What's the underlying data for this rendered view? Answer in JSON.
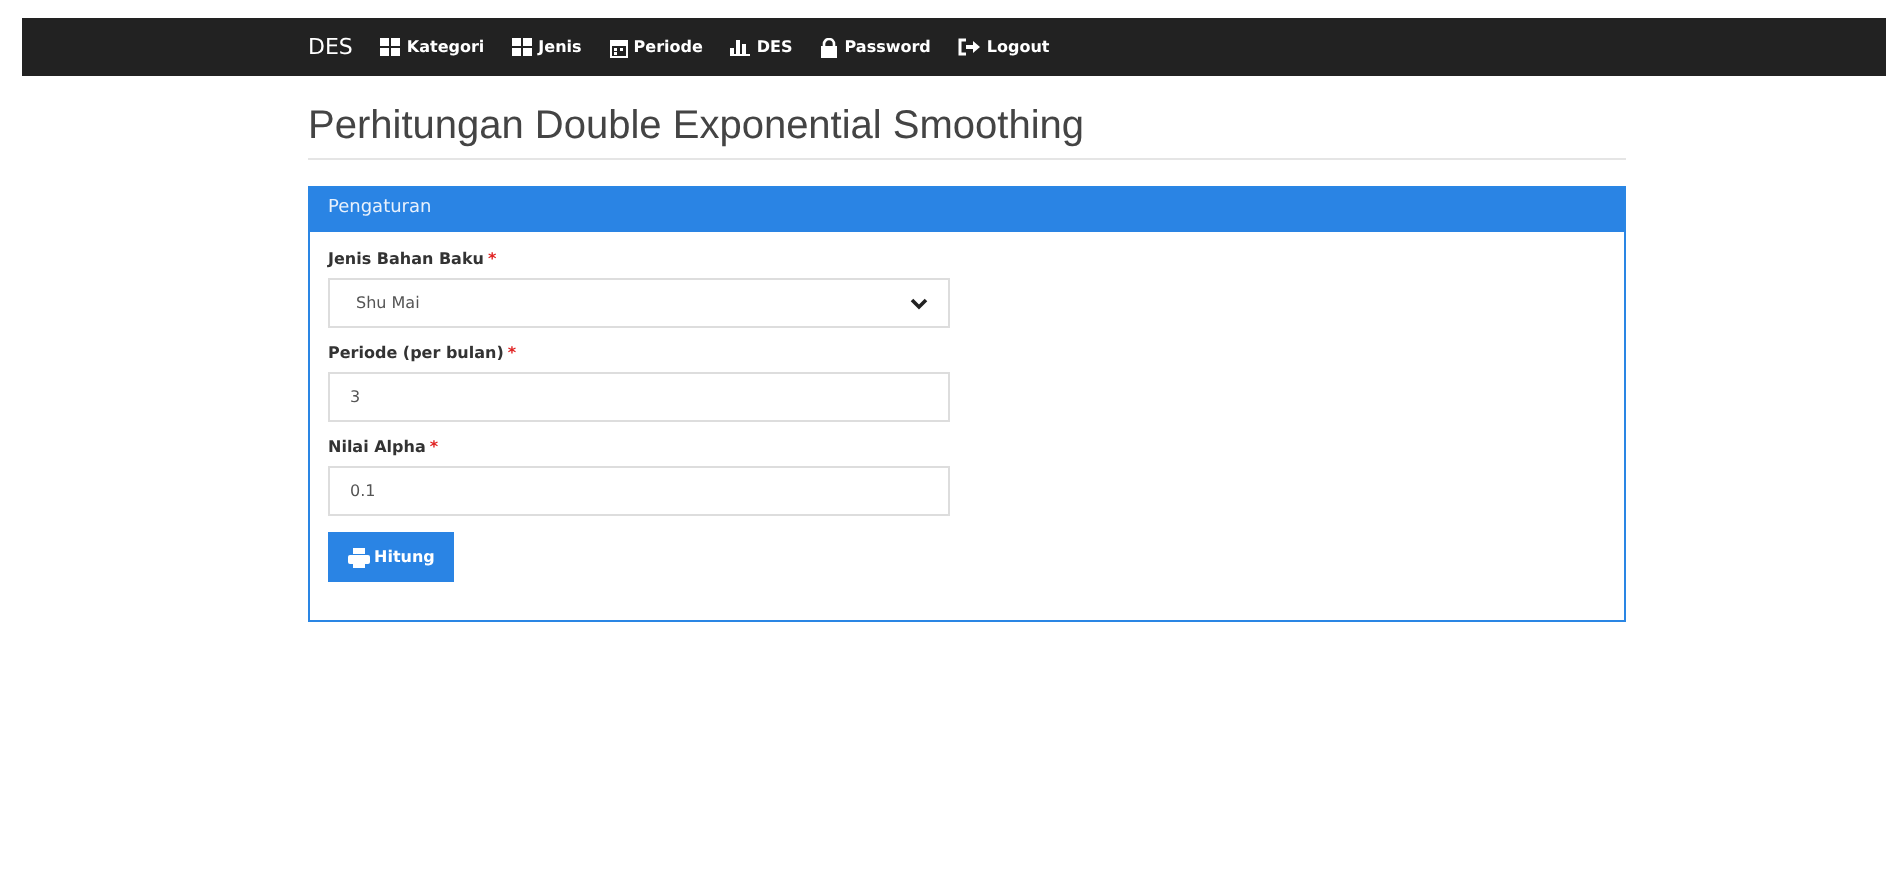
{
  "navbar": {
    "brand": "DES",
    "items": [
      {
        "label": "Kategori"
      },
      {
        "label": "Jenis"
      },
      {
        "label": "Periode"
      },
      {
        "label": "DES"
      },
      {
        "label": "Password"
      },
      {
        "label": "Logout"
      }
    ]
  },
  "page_title": "Perhitungan Double Exponential Smoothing",
  "panel": {
    "heading": "Pengaturan",
    "fields": [
      {
        "kind": "select",
        "label": "Jenis Bahan Baku",
        "required_mark": "*",
        "value": "Shu Mai"
      },
      {
        "kind": "input",
        "label": "Periode (per bulan)",
        "required_mark": "*",
        "value": "3"
      },
      {
        "kind": "input",
        "label": "Nilai Alpha",
        "required_mark": "*",
        "value": "0.1"
      }
    ],
    "button": "Hitung"
  }
}
